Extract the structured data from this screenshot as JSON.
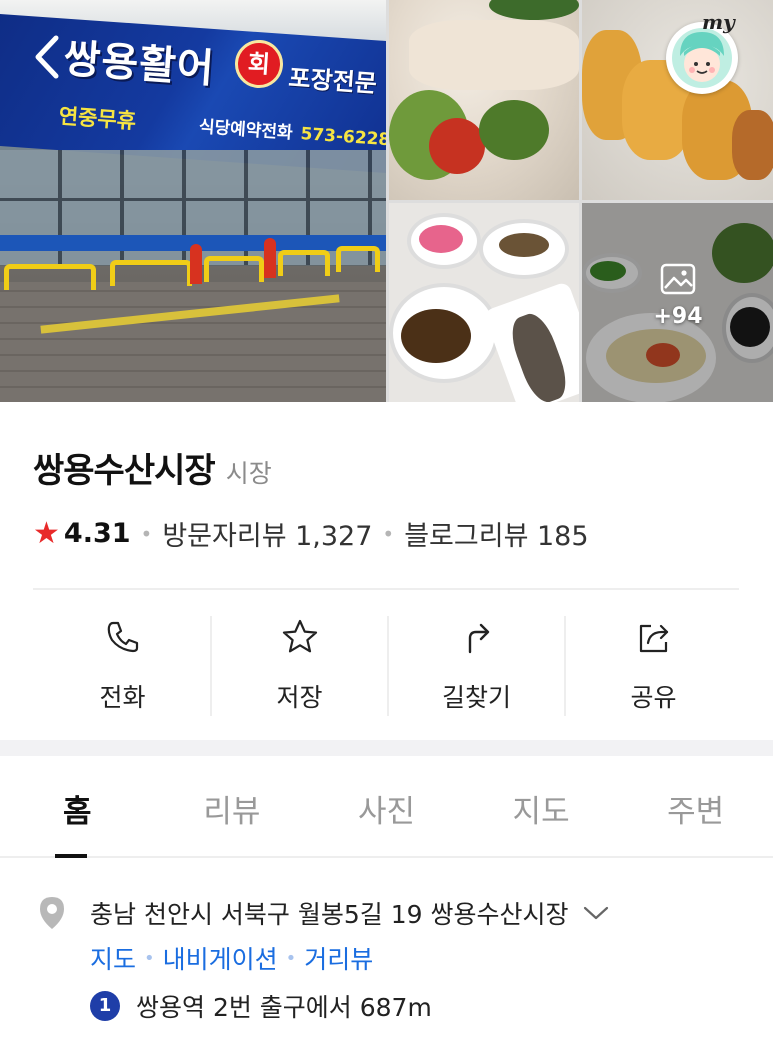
{
  "header": {
    "photo_sign": {
      "title": "쌍용활어",
      "hoe": "회",
      "tail": "포장전문",
      "sub1": "연중무휴",
      "sub2": "식당예약전화",
      "phone": "573-6228"
    },
    "more_photos_count": "+94",
    "my_label": "my"
  },
  "place": {
    "name": "쌍용수산시장",
    "category": "시장",
    "rating": "4.31",
    "visitor_reviews": "방문자리뷰 1,327",
    "blog_reviews": "블로그리뷰 185"
  },
  "actions": [
    {
      "label": "전화",
      "icon": "phone-icon"
    },
    {
      "label": "저장",
      "icon": "star-icon"
    },
    {
      "label": "길찾기",
      "icon": "directions-icon"
    },
    {
      "label": "공유",
      "icon": "share-icon"
    }
  ],
  "tabs": [
    "홈",
    "리뷰",
    "사진",
    "지도",
    "주변"
  ],
  "active_tab": "홈",
  "address": {
    "text": "충남 천안시 서북구 월봉5길 19 쌍용수산시장",
    "links": [
      "지도",
      "내비게이션",
      "거리뷰"
    ],
    "transit_line": "1",
    "transit_text": "쌍용역 2번 출구에서 687m"
  },
  "colors": {
    "accent_blue": "#1a6de0",
    "star_red": "#e82a2a",
    "line1_badge": "#1f3ea8"
  }
}
